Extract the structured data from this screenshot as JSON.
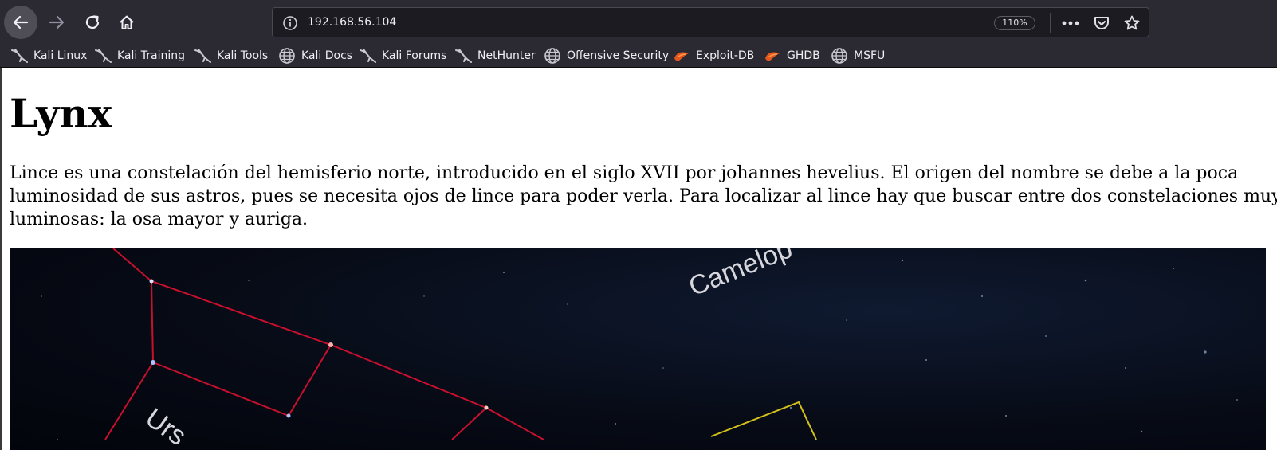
{
  "browser": {
    "url": "192.168.56.104",
    "zoom": "110%",
    "nav_icons": [
      "back-arrow-icon",
      "forward-arrow-icon",
      "reload-icon",
      "home-icon"
    ],
    "url_icons": [
      "info-icon",
      "more-dots-icon",
      "pocket-icon",
      "star-icon"
    ],
    "accent_color": "#4f4e57"
  },
  "bookmarks": [
    {
      "label": "Kali Linux",
      "icon": "kali-dragon-icon"
    },
    {
      "label": "Kali Training",
      "icon": "kali-dragon-icon"
    },
    {
      "label": "Kali Tools",
      "icon": "kali-dragon-icon"
    },
    {
      "label": "Kali Docs",
      "icon": "globe-icon"
    },
    {
      "label": "Kali Forums",
      "icon": "kali-dragon-icon"
    },
    {
      "label": "NetHunter",
      "icon": "kali-dragon-icon"
    },
    {
      "label": "Offensive Security",
      "icon": "globe-icon"
    },
    {
      "label": "Exploit-DB",
      "icon": "exploit-db-icon"
    },
    {
      "label": "GHDB",
      "icon": "exploit-db-icon"
    },
    {
      "label": "MSFU",
      "icon": "globe-icon"
    }
  ],
  "page": {
    "title": "Lynx",
    "paragraph": "Lince es una constelación del hemisferio norte, introducido en el siglo XVII por johannes hevelius. El origen del nombre se debe a la poca luminosidad de sus astros, pues se necesita ojos de lince para poder verla. Para localizar al lince hay que buscar entre dos constelaciones muy luminosas: la osa mayor y auriga.",
    "image": {
      "label_camelopardalis": "Camelop",
      "label_ursa": "Urs",
      "line_color_red": "#c8102e",
      "line_color_yellow": "#d4c21a"
    }
  }
}
